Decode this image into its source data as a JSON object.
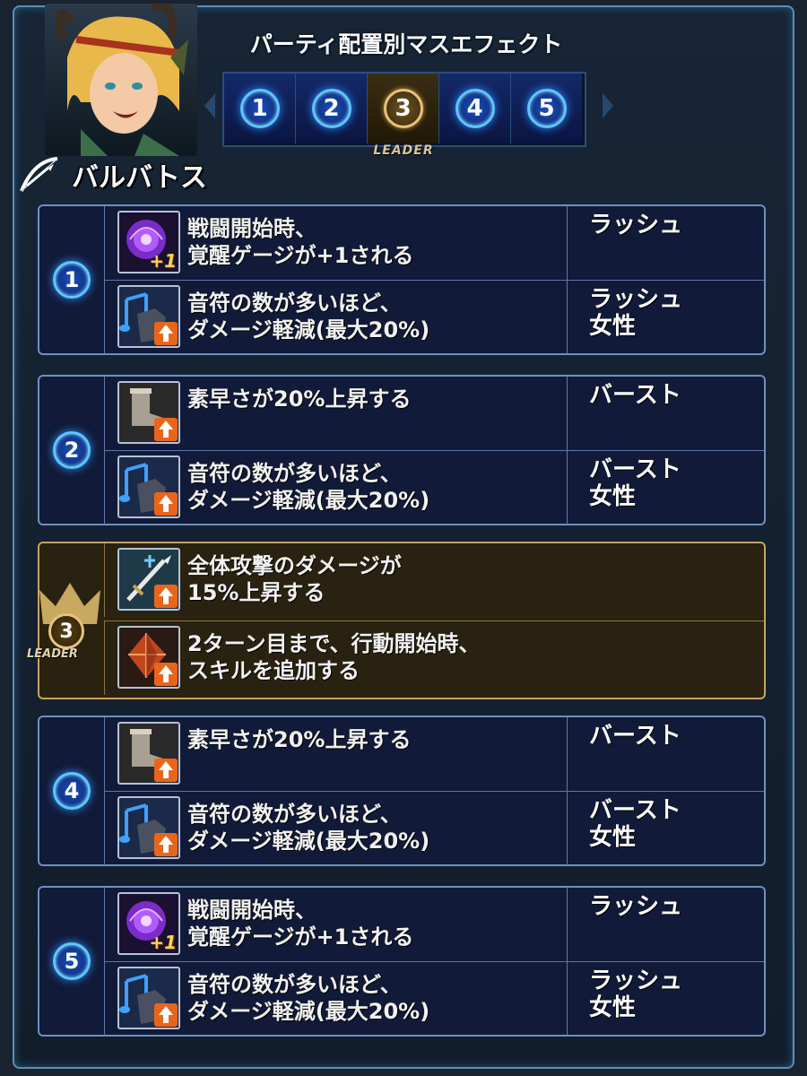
{
  "header": {
    "title": "パーティ配置別マスエフェクト",
    "character_name": "バルバトス",
    "slots": [
      "1",
      "2",
      "3",
      "4",
      "5"
    ],
    "active_slot": 3,
    "leader_label": "LEADER"
  },
  "colors": {
    "accent_blue": "#5ec6ff",
    "leader_gold": "#c6a45c",
    "arrow_orange": "#e9651c"
  },
  "groups": [
    {
      "number": "1",
      "leader": false,
      "rows": [
        {
          "icon": "awakening-orb-icon",
          "icon_badge": "+1",
          "text": "戦闘開始時、\n覚醒ゲージが+1される",
          "condition": "ラッシュ"
        },
        {
          "icon": "music-note-shield-icon",
          "text": "音符の数が多いほど、\nダメージ軽減(最大20%)",
          "condition": "ラッシュ\n女性"
        }
      ]
    },
    {
      "number": "2",
      "leader": false,
      "rows": [
        {
          "icon": "boot-speed-icon",
          "text": "素早さが20%上昇する",
          "condition": "バースト"
        },
        {
          "icon": "music-note-shield-icon",
          "text": "音符の数が多いほど、\nダメージ軽減(最大20%)",
          "condition": "バースト\n女性"
        }
      ]
    },
    {
      "number": "3",
      "leader": true,
      "leader_label": "LEADER",
      "rows": [
        {
          "icon": "sword-all-attack-icon",
          "text": "全体攻撃のダメージが\n15%上昇する",
          "condition": ""
        },
        {
          "icon": "crystal-skill-icon",
          "text": "2ターン目まで、行動開始時、\nスキルを追加する",
          "condition": ""
        }
      ]
    },
    {
      "number": "4",
      "leader": false,
      "rows": [
        {
          "icon": "boot-speed-icon",
          "text": "素早さが20%上昇する",
          "condition": "バースト"
        },
        {
          "icon": "music-note-shield-icon",
          "text": "音符の数が多いほど、\nダメージ軽減(最大20%)",
          "condition": "バースト\n女性"
        }
      ]
    },
    {
      "number": "5",
      "leader": false,
      "rows": [
        {
          "icon": "awakening-orb-icon",
          "icon_badge": "+1",
          "text": "戦闘開始時、\n覚醒ゲージが+1される",
          "condition": "ラッシュ"
        },
        {
          "icon": "music-note-shield-icon",
          "text": "音符の数が多いほど、\nダメージ軽減(最大20%)",
          "condition": "ラッシュ\n女性"
        }
      ]
    }
  ]
}
